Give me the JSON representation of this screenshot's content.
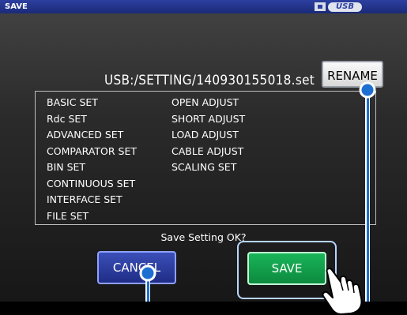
{
  "top_bar": {
    "title": "SAVE",
    "usb_label": "USB"
  },
  "save_dialog": {
    "path": "USB:/SETTING/140930155018.set",
    "rename_button": "RENAME",
    "items_left": [
      "BASIC SET",
      "Rdc SET",
      "ADVANCED SET",
      "COMPARATOR SET",
      "BIN SET",
      "CONTINUOUS SET",
      "INTERFACE SET",
      "FILE SET"
    ],
    "items_right": [
      "OPEN ADJUST",
      "SHORT ADJUST",
      "LOAD ADJUST",
      "CABLE ADJUST",
      "SCALING SET"
    ],
    "question": "Save Setting OK?",
    "cancel_button": "CANCEL",
    "save_button": "SAVE"
  },
  "colors": {
    "accent_blue": "#1d6fd1",
    "save_green": "#0d8a3e",
    "cancel_blue": "#1f2d86"
  },
  "icons": [
    "usb-drive-icon",
    "pointing-hand-icon",
    "callout-marker-icon"
  ]
}
